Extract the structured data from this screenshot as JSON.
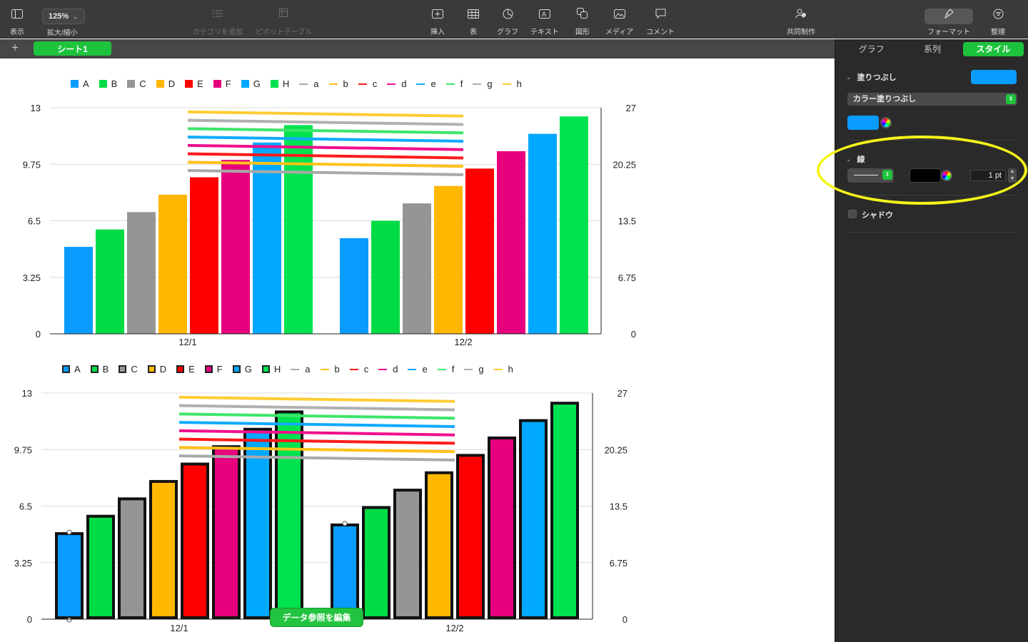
{
  "toolbar": {
    "view_label": "表示",
    "zoom_value": "125%",
    "zoom_label": "拡大/縮小",
    "add_category_label": "カテゴリを追加",
    "pivot_label": "ピボットテーブル",
    "insert_label": "挿入",
    "table_label": "表",
    "chart_label": "グラフ",
    "text_label": "テキスト",
    "shape_label": "図形",
    "media_label": "メディア",
    "comment_label": "コメント",
    "collaborate_label": "共同制作",
    "format_label": "フォーマット",
    "organize_label": "整理"
  },
  "sheets": {
    "add_label": "+",
    "active_sheet": "シート1"
  },
  "colors": {
    "A": "#0a9bff",
    "B": "#00dc45",
    "C": "#959595",
    "D": "#ffb700",
    "E": "#ff0000",
    "F": "#e6007e",
    "G": "#00a8ff",
    "H": "#00e24f",
    "accent": "#1ec33d"
  },
  "chart_data": [
    {
      "type": "bar",
      "categories": [
        "12/1",
        "12/2"
      ],
      "series": [
        {
          "name": "A",
          "values": [
            5.0,
            5.5
          ]
        },
        {
          "name": "B",
          "values": [
            6.0,
            6.5
          ]
        },
        {
          "name": "C",
          "values": [
            7.0,
            7.5
          ]
        },
        {
          "name": "D",
          "values": [
            8.0,
            8.5
          ]
        },
        {
          "name": "E",
          "values": [
            9.0,
            9.5
          ]
        },
        {
          "name": "F",
          "values": [
            10.0,
            10.5
          ]
        },
        {
          "name": "G",
          "values": [
            11.0,
            11.5
          ]
        },
        {
          "name": "H",
          "values": [
            12.0,
            12.5
          ]
        }
      ],
      "line_series": [
        {
          "name": "a",
          "values": [
            19.5,
            19.0
          ]
        },
        {
          "name": "b",
          "values": [
            20.5,
            20.0
          ]
        },
        {
          "name": "c",
          "values": [
            21.5,
            21.0
          ]
        },
        {
          "name": "d",
          "values": [
            22.5,
            22.0
          ]
        },
        {
          "name": "e",
          "values": [
            23.5,
            23.0
          ]
        },
        {
          "name": "f",
          "values": [
            24.5,
            24.0
          ]
        },
        {
          "name": "g",
          "values": [
            25.5,
            25.0
          ]
        },
        {
          "name": "h",
          "values": [
            26.5,
            26.0
          ]
        }
      ],
      "ylim": [
        0,
        13
      ],
      "y_ticks": [
        "0",
        "3.25",
        "6.5",
        "9.75",
        "13"
      ],
      "y2lim": [
        0,
        27
      ],
      "y2_ticks": [
        "0",
        "6.75",
        "13.5",
        "20.25",
        "27"
      ],
      "bar_outline": false,
      "grid": true,
      "legend": "top"
    },
    {
      "type": "bar",
      "categories": [
        "12/1",
        "12/2"
      ],
      "series": [
        {
          "name": "A",
          "values": [
            5.0,
            5.5
          ]
        },
        {
          "name": "B",
          "values": [
            6.0,
            6.5
          ]
        },
        {
          "name": "C",
          "values": [
            7.0,
            7.5
          ]
        },
        {
          "name": "D",
          "values": [
            8.0,
            8.5
          ]
        },
        {
          "name": "E",
          "values": [
            9.0,
            9.5
          ]
        },
        {
          "name": "F",
          "values": [
            10.0,
            10.5
          ]
        },
        {
          "name": "G",
          "values": [
            11.0,
            11.5
          ]
        },
        {
          "name": "H",
          "values": [
            12.0,
            12.5
          ]
        }
      ],
      "line_series": [
        {
          "name": "a",
          "values": [
            19.5,
            19.0
          ]
        },
        {
          "name": "b",
          "values": [
            20.5,
            20.0
          ]
        },
        {
          "name": "c",
          "values": [
            21.5,
            21.0
          ]
        },
        {
          "name": "d",
          "values": [
            22.5,
            22.0
          ]
        },
        {
          "name": "e",
          "values": [
            23.5,
            23.0
          ]
        },
        {
          "name": "f",
          "values": [
            24.5,
            24.0
          ]
        },
        {
          "name": "g",
          "values": [
            25.5,
            25.0
          ]
        },
        {
          "name": "h",
          "values": [
            26.5,
            26.0
          ]
        }
      ],
      "ylim": [
        0,
        13
      ],
      "y_ticks": [
        "0",
        "3.25",
        "6.5",
        "9.75",
        "13"
      ],
      "y2lim": [
        0,
        27
      ],
      "y2_ticks": [
        "0",
        "6.75",
        "13.5",
        "20.25",
        "27"
      ],
      "bar_outline": true,
      "grid": true,
      "legend": "top"
    }
  ],
  "line_colors": {
    "a": "#a9a9a9",
    "b": "#ffc21a",
    "c": "#ff1a1a",
    "d": "#f0108c",
    "e": "#10aaff",
    "f": "#3de66a",
    "g": "#b0b0b0",
    "h": "#ffcc33"
  },
  "edit_data_ref_label": "データ参照を編集",
  "panel": {
    "tabs": [
      "グラフ",
      "系列",
      "スタイル"
    ],
    "active_tab": "スタイル",
    "fill_title": "塗りつぶし",
    "fill_color": "#0a9bff",
    "fill_type": "カラー塗りつぶし",
    "stroke_title": "線",
    "stroke_color": "#000000",
    "stroke_width": "1 pt",
    "shadow_label": "シャドウ",
    "shadow_checked": false
  }
}
